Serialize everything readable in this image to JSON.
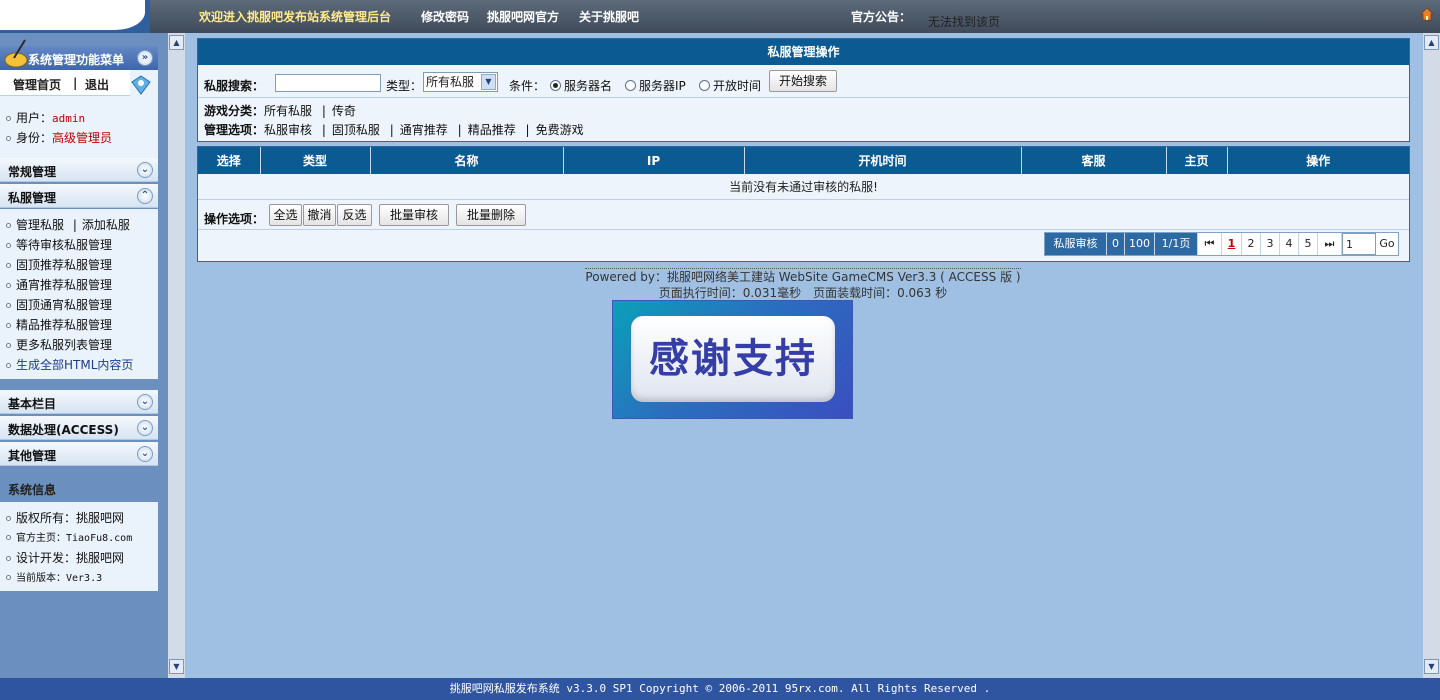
{
  "topbar": {
    "welcome": "欢迎进入挑服吧发布站系统管理后台",
    "change_password": "修改密码",
    "official": "挑服吧网官方",
    "about": "关于挑服吧",
    "notice_label": "官方公告：",
    "notice_text": "无法找到该页"
  },
  "sidebar": {
    "title": "系统管理功能菜单",
    "home": "管理首页",
    "divider": "|",
    "logout": "退出",
    "user_label": "用户：",
    "user_value": "admin",
    "role_label": "身份：",
    "role_value": "高级管理员",
    "sections": {
      "general": "常规管理",
      "server_mgmt": "私服管理",
      "basic": "基本栏目",
      "data": "数据处理(ACCESS)",
      "other": "其他管理",
      "sysinfo": "系统信息"
    },
    "server_items": {
      "manage": "管理私服",
      "add": "添加私服",
      "pending": "等待审核私服管理",
      "pinned": "固顶推荐私服管理",
      "normal": "通宵推荐私服管理",
      "pinned_normal": "固顶通宵私服管理",
      "premium": "精品推荐私服管理",
      "more": "更多私服列表管理",
      "generate": "生成全部HTML内容页"
    },
    "sysinfo_items": {
      "copyright": "版权所有：挑服吧网",
      "site": "官方主页：TiaoFu8.com",
      "dev": "设计开发：挑服吧网",
      "version": "当前版本：Ver3.3"
    }
  },
  "search_panel": {
    "title": "私服管理操作",
    "search_label": "私服搜索：",
    "search_value": "",
    "type_label": "类型：",
    "type_selected": "所有私服",
    "cond_label": "条件：",
    "radio_name": "服务器名",
    "radio_ip": "服务器IP",
    "radio_time": "开放时间",
    "search_button": "开始搜索",
    "category_label": "游戏分类：",
    "cat_all": "所有私服",
    "cat_legend": "传奇",
    "options_label": "管理选项：",
    "opt_review": "私服审核",
    "opt_pinned": "固顶私服",
    "opt_normal": "通宵推荐",
    "opt_premium": "精品推荐",
    "opt_free": "免费游戏",
    "sep": "|"
  },
  "table": {
    "headers": [
      "选择",
      "类型",
      "名称",
      "IP",
      "开机时间",
      "客服",
      "主页",
      "操作"
    ],
    "empty_message": "当前没有未通过审核的私服!",
    "ops_label": "操作选项：",
    "btn_all": "全选",
    "btn_cancel": "撤消",
    "btn_invert": "反选",
    "btn_batch_review": "批量审核",
    "btn_batch_delete": "批量删除"
  },
  "pager": {
    "label": "私服审核",
    "total": "0",
    "per_page": "100",
    "pages": "1/1页",
    "first": "⏮",
    "numbers": [
      "1",
      "2",
      "3",
      "4",
      "5"
    ],
    "current": "1",
    "last": "⏭",
    "input_value": "1",
    "go": "Go"
  },
  "footer_info": {
    "powered": "Powered by：挑服吧网络美工建站 WebSite GameCMS Ver3.3 ( ACCESS 版 )",
    "timing": "页面执行时间：0.031毫秒　页面装载时间：0.063 秒"
  },
  "banner_text": "感谢支持",
  "bottom_bar": "挑服吧网私服发布系统 v3.3.0 SP1    Copyright © 2006-2011 95rx.com. All Rights Reserved .",
  "colors": {
    "header_blue": "#0b5a92",
    "panel_bg": "#eef4fb",
    "page_bg": "#9fc0e3",
    "accent_red": "#c00000"
  }
}
